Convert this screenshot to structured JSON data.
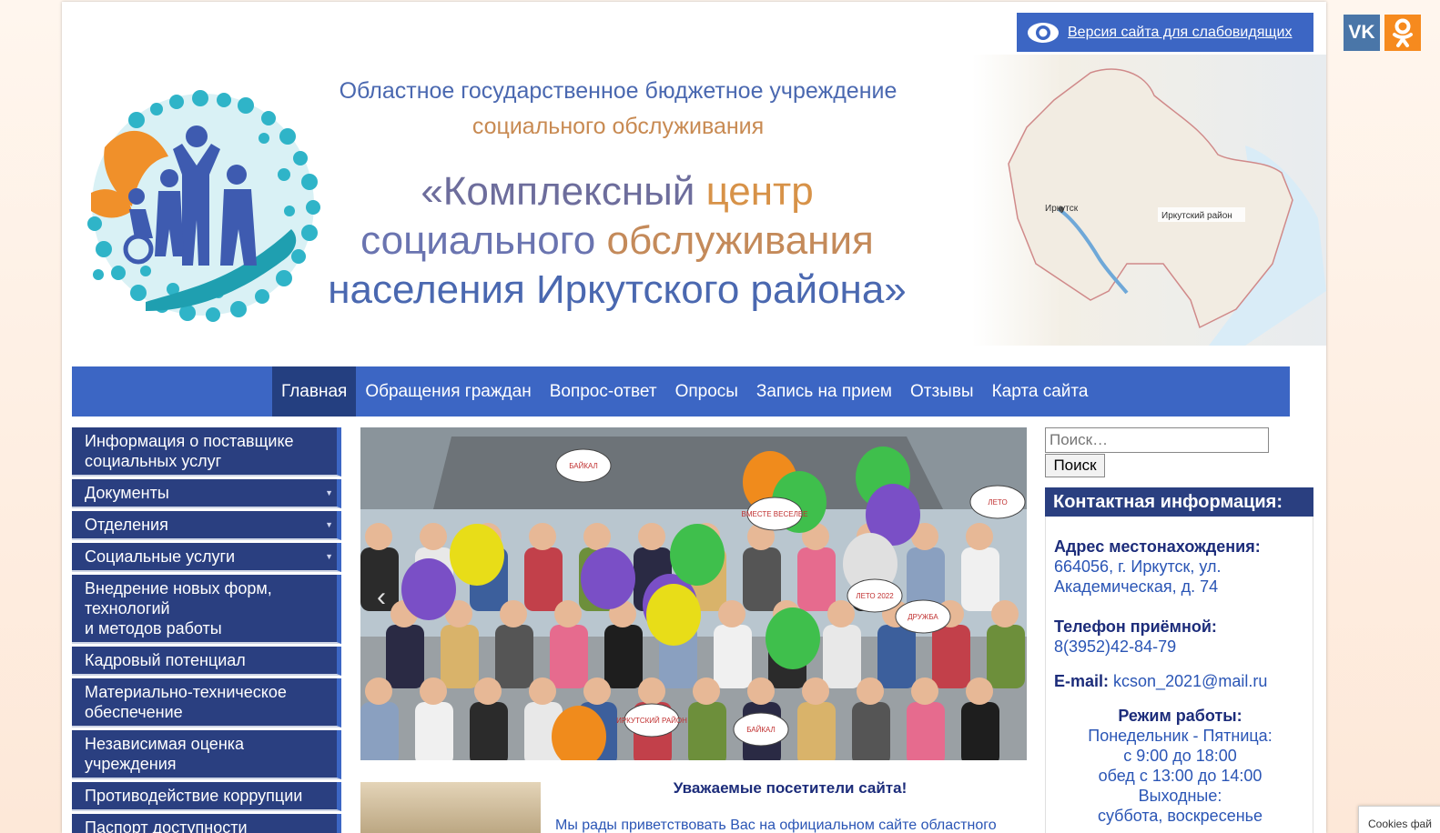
{
  "header": {
    "low_vision_label": "Версия сайта для слабовидящих",
    "org_line1": "Областное государственное бюджетное учреждение",
    "org_line2": "социального обслуживания",
    "title_part1": "«Комплексный ",
    "title_part2": "центр",
    "title_line2a": "социального ",
    "title_line2b": "обслуживания",
    "title_line3": "населения Иркутского района»",
    "map_label_city": "Иркутск",
    "map_label_district": "Иркутский район"
  },
  "nav": {
    "items": [
      {
        "label": "Главная",
        "active": true
      },
      {
        "label": "Обращения граждан"
      },
      {
        "label": "Вопрос-ответ"
      },
      {
        "label": "Опросы"
      },
      {
        "label": "Запись на прием"
      },
      {
        "label": "Отзывы"
      },
      {
        "label": "Карта сайта"
      }
    ]
  },
  "sidebar": {
    "items": [
      {
        "label": "Информация о поставщике социальных услуг"
      },
      {
        "label": "Документы",
        "caret": true
      },
      {
        "label": "Отделения",
        "caret": true
      },
      {
        "label": "Социальные услуги",
        "caret": true
      },
      {
        "label": "Внедрение новых форм, технологий",
        "label2": "и методов работы"
      },
      {
        "label": "Кадровый потенциал"
      },
      {
        "label": "Материально-техническое обеспечение"
      },
      {
        "label": "Независимая оценка учреждения"
      },
      {
        "label": "Противодействие коррупции"
      },
      {
        "label": "Паспорт доступности"
      }
    ]
  },
  "slider": {
    "prev_glyph": "‹",
    "sign_texts": [
      "БАЙКАЛ",
      "ЛЕТО",
      "ВМЕСТЕ ВЕСЕЛЕЕ",
      "ДРУЖБА",
      "ЛЕТО 2022",
      "БАЙКАЛ",
      "ИРКУТСКИЙ РАЙОН"
    ]
  },
  "welcome": {
    "title": "Уважаемые посетители сайта!",
    "body": "Мы рады приветствовать Вас на официальном сайте областного"
  },
  "search": {
    "placeholder": "Поиск…",
    "button": "Поиск"
  },
  "contacts": {
    "heading": "Контактная информация:",
    "address_label": "Адрес местонахождения:",
    "address_value": "664056, г. Иркутск, ул. Академическая, д. 74",
    "phone_label": "Телефон приёмной:",
    "phone_value": "8(3952)42-84-79",
    "email_label": "E-mail:",
    "email_value": "kcson_2021@mail.ru",
    "hours_label": "Режим работы:",
    "hours_lines": [
      "Понедельник - Пятница:",
      "с 9:00 до 18:00",
      "обед с 13:00 до 14:00",
      "Выходные:",
      "суббота, воскресенье"
    ]
  },
  "social": {
    "vk_label": "VK",
    "vk_icon": "vk-icon",
    "ok_icon": "odnoklassniki-icon"
  },
  "cookies": {
    "text": "Cookies фай"
  },
  "colors": {
    "nav_blue": "#3c66c4",
    "sidebar_navy": "#2a3f80",
    "text_blue": "#2a55b5",
    "accent_orange": "#d79248"
  }
}
